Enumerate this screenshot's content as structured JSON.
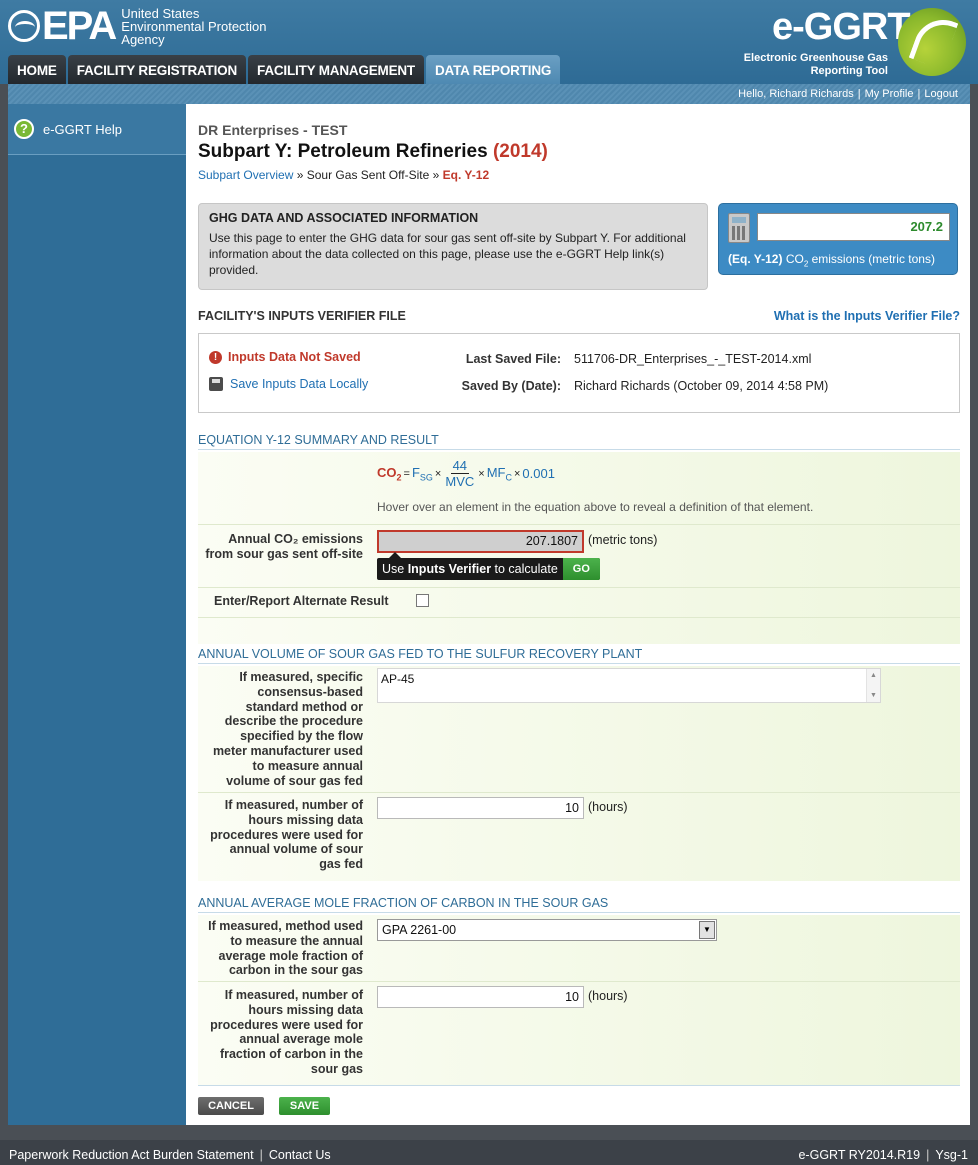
{
  "header": {
    "epa_logo": "EPA",
    "epa_agency_lines": [
      "United States",
      "Environmental Protection",
      "Agency"
    ],
    "app_logo": "e-GGRT",
    "app_subtitle_lines": [
      "Electronic Greenhouse Gas",
      "Reporting Tool"
    ]
  },
  "nav": {
    "tabs": [
      {
        "label": "HOME",
        "active": false
      },
      {
        "label": "FACILITY REGISTRATION",
        "active": false
      },
      {
        "label": "FACILITY MANAGEMENT",
        "active": false
      },
      {
        "label": "DATA REPORTING",
        "active": true
      }
    ]
  },
  "userbar": {
    "greeting": "Hello, Richard Richards",
    "profile": "My Profile",
    "logout": "Logout"
  },
  "sidebar": {
    "help_icon": "?",
    "help_label": "e-GGRT Help"
  },
  "page": {
    "org": "DR Enterprises - TEST",
    "title": "Subpart Y: Petroleum Refineries",
    "year": "(2014)",
    "breadcrumb": {
      "overview": "Subpart Overview",
      "sep": "»",
      "middle": "Sour Gas Sent Off-Site",
      "current": "Eq. Y-12"
    }
  },
  "info_box": {
    "title": "GHG DATA AND ASSOCIATED INFORMATION",
    "body": "Use this page to enter the GHG data for sour gas sent off-site by Subpart Y. For additional information about the data collected on this page, please use the e-GGRT Help link(s) provided."
  },
  "calc": {
    "value": "207.2",
    "eq": "(Eq. Y-12)",
    "label_a": "CO",
    "label_sub": "2",
    "label_b": " emissions (metric tons)"
  },
  "verifier": {
    "title": "FACILITY'S INPUTS VERIFIER FILE",
    "help_link": "What is the Inputs Verifier File?",
    "not_saved": "Inputs Data Not Saved",
    "save_local": "Save Inputs Data Locally",
    "last_saved_label": "Last Saved File:",
    "last_saved_value": "511706-DR_Enterprises_-_TEST-2014.xml",
    "saved_by_label": "Saved By (Date):",
    "saved_by_value": "Richard Richards (October 09, 2014 4:58 PM)"
  },
  "summary": {
    "title": "EQUATION Y-12 SUMMARY AND RESULT",
    "eq": {
      "lhs": "CO",
      "lhs_sub": "2",
      "eq_sign": "=",
      "fsg": "F",
      "fsg_sub": "SG",
      "times": "×",
      "num": "44",
      "den": "MVC",
      "mfc": "MF",
      "mfc_sub": "C",
      "const": "0.001"
    },
    "hint": "Hover over an element in the equation above to reveal a definition of that element.",
    "result_label_lines": [
      "Annual CO₂ emissions",
      "from sour gas sent off-site"
    ],
    "result_value": "207.1807",
    "result_unit": "(metric tons)",
    "tip_prefix": "Use ",
    "tip_bold": "Inputs Verifier",
    "tip_suffix": " to calculate",
    "go": "GO",
    "alt_label": "Enter/Report Alternate Result",
    "alt_checked": false
  },
  "volume": {
    "title": "ANNUAL VOLUME OF SOUR GAS FED TO THE SULFUR RECOVERY PLANT",
    "method_label_lines": [
      "If measured, specific",
      "consensus-based",
      "standard method or",
      "describe the procedure",
      "specified by the flow",
      "meter manufacturer used",
      "to measure annual",
      "volume of sour gas fed"
    ],
    "method_value": "AP-45",
    "hours_label_lines": [
      "If measured, number of",
      "hours missing data",
      "procedures were used for",
      "annual volume of sour",
      "gas fed"
    ],
    "hours_value": "10",
    "hours_unit": "(hours)"
  },
  "carbon": {
    "title": "ANNUAL AVERAGE MOLE FRACTION OF CARBON IN THE SOUR GAS",
    "method_label_lines": [
      "If measured, method used",
      "to measure the annual",
      "average mole fraction of",
      "carbon in the sour gas"
    ],
    "method_value": "GPA 2261-00",
    "hours_label_lines": [
      "If measured, number of",
      "hours missing data",
      "procedures were used for",
      "annual average mole",
      "fraction of carbon in the",
      "sour gas"
    ],
    "hours_value": "10",
    "hours_unit": "(hours)"
  },
  "actions": {
    "cancel": "CANCEL",
    "save": "SAVE"
  },
  "footer": {
    "paperwork": "Paperwork Reduction Act Burden Statement",
    "contact": "Contact Us",
    "version": "e-GGRT RY2014.R19",
    "server": "Ysg-1"
  },
  "colors": {
    "header_blue": "#3f7ba3",
    "sidebar_blue": "#2f6d97",
    "accent_red": "#c0392b",
    "link_blue": "#1f6fb2",
    "go_green": "#2e8f2e"
  }
}
